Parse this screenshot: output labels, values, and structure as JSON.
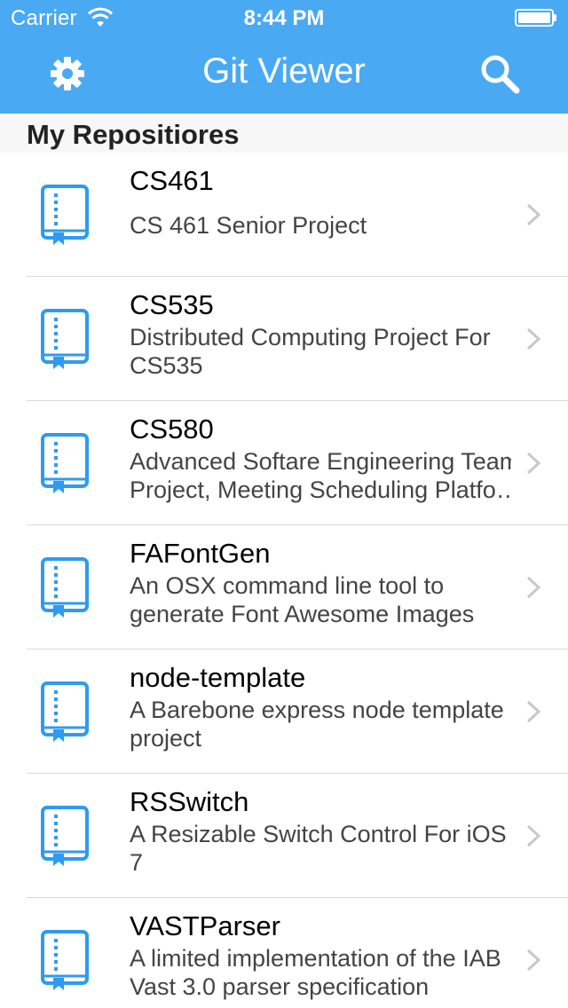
{
  "status_bar": {
    "carrier": "Carrier",
    "time": "8:44 PM"
  },
  "nav": {
    "title": "Git Viewer",
    "left_icon": "gear-icon",
    "right_icon": "search-icon"
  },
  "section": {
    "title": "My Repositiores"
  },
  "repos": [
    {
      "name": "CS461",
      "desc_lines": [
        "CS 461 Senior Project"
      ]
    },
    {
      "name": "CS535",
      "desc_lines": [
        "Distributed Computing Project For",
        "CS535"
      ]
    },
    {
      "name": "CS580",
      "desc_lines": [
        "Advanced Softare Engineering Team",
        "Project, Meeting Scheduling Platfo…"
      ]
    },
    {
      "name": "FAFontGen",
      "desc_lines": [
        "An OSX command line tool to",
        "generate Font Awesome Images"
      ]
    },
    {
      "name": "node-template",
      "desc_lines": [
        "A Barebone express node template",
        "project"
      ]
    },
    {
      "name": "RSSwitch",
      "desc_lines": [
        "A Resizable Switch Control For iOS",
        "7"
      ]
    },
    {
      "name": "VASTParser",
      "desc_lines": [
        "A limited implementation of the IAB",
        "Vast 3.0 parser specification"
      ]
    }
  ],
  "colors": {
    "accent": "#4aa9f3",
    "icon_blue": "#2e9bf0",
    "chevron": "#c7c7cc"
  }
}
